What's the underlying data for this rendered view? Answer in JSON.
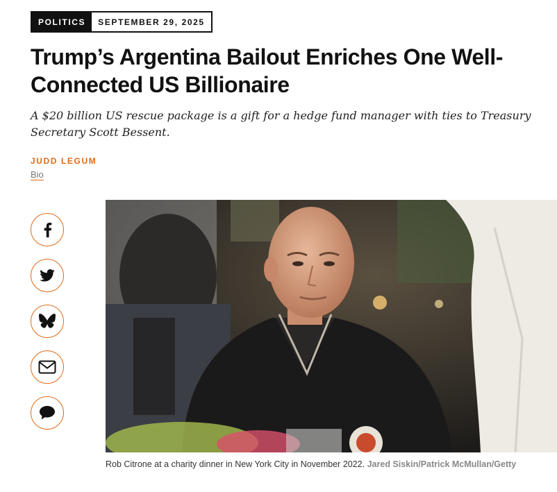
{
  "article": {
    "category": "POLITICS",
    "date": "SEPTEMBER 29, 2025",
    "headline": "Trump’s Argentina Bailout Enriches One Well-Connected US Billionaire",
    "dek": "A $20 billion US rescue package is a gift for a hedge fund manager with ties to Treasury Secretary Scott Bessent.",
    "author": "JUDD LEGUM",
    "bio_link": "Bio"
  },
  "share": {
    "icons": [
      "facebook-icon",
      "twitter-icon",
      "bluesky-icon",
      "email-icon",
      "comment-icon"
    ]
  },
  "photo": {
    "caption": "Rob Citrone at a charity dinner in New York City in November 2022.",
    "credit": "Jared Siskin/Patrick McMullan/Getty"
  },
  "colors": {
    "accent": "#e06a17",
    "ink": "#111111"
  }
}
